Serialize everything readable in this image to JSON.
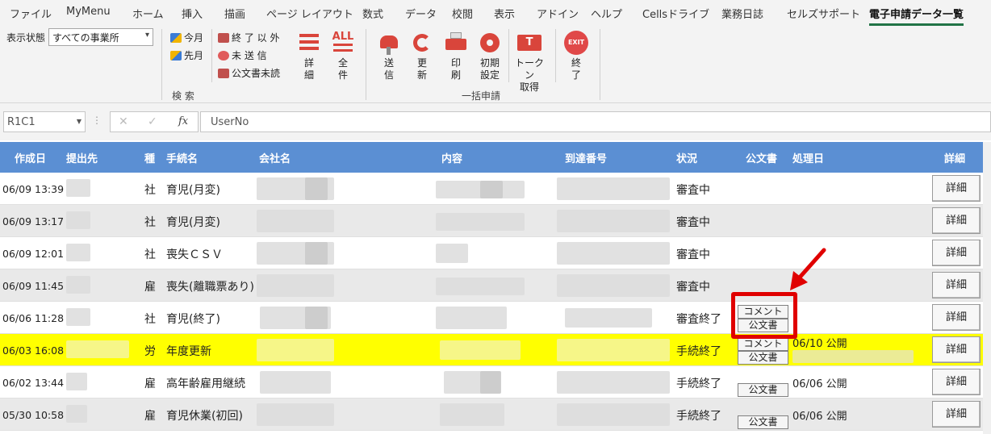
{
  "ribbon_tabs": [
    "ファイル",
    "MyMenu",
    "ホーム",
    "挿入",
    "描画",
    "ページ レイアウト",
    "数式",
    "データ",
    "校閲",
    "表示",
    "アドイン",
    "ヘルプ",
    "Cellsドライブ",
    "業務日誌",
    "セルズサポート",
    "電子申請データ一覧"
  ],
  "active_tab": "電子申請データ一覧",
  "filter": {
    "label": "表示状態",
    "value": "すべての事業所"
  },
  "search_group": {
    "label": "検 索",
    "this_month": "今月",
    "last_month": "先月",
    "other_than_done": "終 了 以 外",
    "unsent": "未 送 信",
    "doc_unread": "公文書未読",
    "detail": "詳\n細",
    "all": "全\n件",
    "all_icon_text": "ALL"
  },
  "batch_group": {
    "label": "一括申請",
    "send": "送\n信",
    "refresh": "更\n新",
    "print": "印\n刷",
    "init": "初期\n設定",
    "token": "トークン\n取得",
    "token_icon_text": "T"
  },
  "exit": {
    "label": "終\n了",
    "icon_text": "EXIT"
  },
  "formula_bar": {
    "name_box": "R1C1",
    "fx": "fx",
    "value": "UserNo"
  },
  "columns": [
    "作成日",
    "提出先",
    "種",
    "手続名",
    "会社名",
    "内容",
    "到達番号",
    "状況",
    "公文書",
    "処理日",
    "詳細"
  ],
  "rows": [
    {
      "date": "06/09 13:39",
      "kind": "社",
      "procedure": "育児(月変)",
      "status": "審査中",
      "detail": "詳細"
    },
    {
      "date": "06/09 13:17",
      "kind": "社",
      "procedure": "育児(月変)",
      "status": "審査中",
      "detail": "詳細"
    },
    {
      "date": "06/09 12:01",
      "kind": "社",
      "procedure": "喪失ＣＳＶ",
      "status": "審査中",
      "detail": "詳細"
    },
    {
      "date": "06/09 11:45",
      "kind": "雇",
      "procedure": "喪失(離職票あり)",
      "status": "審査中",
      "detail": "詳細"
    },
    {
      "date": "06/06 11:28",
      "kind": "社",
      "procedure": "育児(終了)",
      "status": "審査終了",
      "comment_btn": "コメント",
      "doc_btn": "公文書",
      "detail": "詳細"
    },
    {
      "date": "06/03 16:08",
      "kind": "労",
      "procedure": "年度更新",
      "status": "手続終了",
      "comment_btn": "コメント",
      "doc_btn": "公文書",
      "processed": "06/10 公開",
      "detail": "詳細"
    },
    {
      "date": "06/02 13:44",
      "kind": "雇",
      "procedure": "高年齢雇用継続",
      "status": "手続終了",
      "doc_btn": "公文書",
      "processed": "06/06 公開",
      "detail": "詳細"
    },
    {
      "date": "05/30 10:58",
      "kind": "雇",
      "procedure": "育児休業(初回)",
      "status": "手続終了",
      "doc_btn": "公文書",
      "processed": "06/06 公開",
      "detail": "詳細"
    }
  ],
  "colors": {
    "header_blue": "#5b8fd3",
    "highlight_yellow": "#ffff00",
    "callout_red": "#e00000",
    "active_tab_underline": "#217346"
  }
}
